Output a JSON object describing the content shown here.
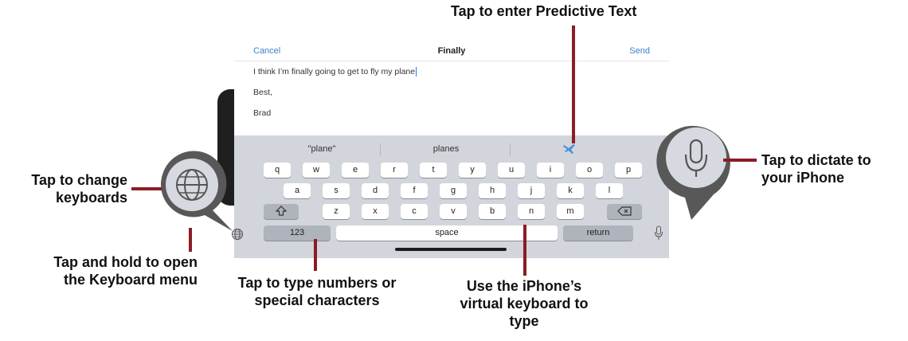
{
  "mail": {
    "cancel": "Cancel",
    "subject": "Finally",
    "send": "Send",
    "body_line1": "I think I’m finally going to get to fly my plane",
    "body_line2": "Best,",
    "body_line3": "Brad"
  },
  "predictive": [
    "\"plane\"",
    "planes",
    "airplane-emoji"
  ],
  "keyboard": {
    "row1": [
      "q",
      "w",
      "e",
      "r",
      "t",
      "y",
      "u",
      "i",
      "o",
      "p"
    ],
    "row2": [
      "a",
      "s",
      "d",
      "f",
      "g",
      "h",
      "j",
      "k",
      "l"
    ],
    "row3": [
      "z",
      "x",
      "c",
      "v",
      "b",
      "n",
      "m"
    ],
    "numbers_label": "123",
    "space_label": "space",
    "return_label": "return",
    "shift_icon": "shift-icon",
    "delete_icon": "delete-icon",
    "globe_icon": "globe-icon",
    "mic_icon": "microphone-icon"
  },
  "callouts": {
    "predictive": "Tap to enter Predictive Text",
    "change_kbd_1": "Tap to change",
    "change_kbd_2": "keyboards",
    "hold_menu_1": "Tap and hold to open",
    "hold_menu_2": "the Keyboard menu",
    "numbers_1": "Tap to type numbers or",
    "numbers_2": "special characters",
    "virtual_1": "Use the iPhone’s",
    "virtual_2": "virtual keyboard to",
    "virtual_3": "type",
    "dictate_1": "Tap to dictate to",
    "dictate_2": "your iPhone"
  },
  "colors": {
    "annotation": "#8c1d25",
    "link_blue": "#3b82c4",
    "keyboard_bg": "#d2d5db"
  }
}
